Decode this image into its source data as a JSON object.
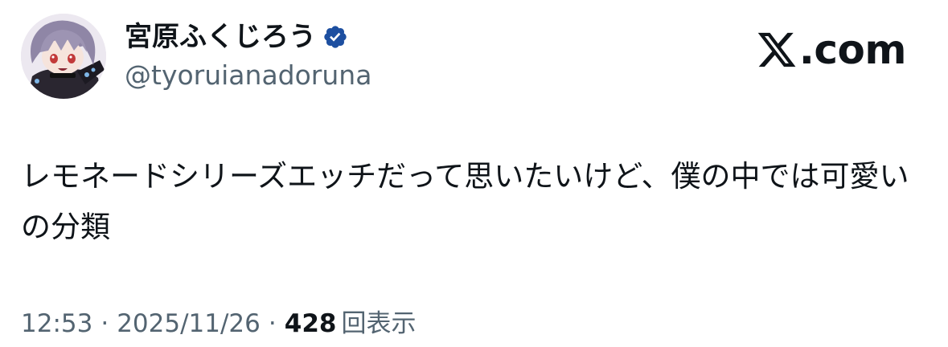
{
  "author": {
    "display_name": "宮原ふくじろう",
    "handle": "@tyoruianadoruna",
    "verified": true,
    "avatar_icon": "anime-character-avatar"
  },
  "brand": {
    "logo_icon": "x-logo-icon",
    "text": ".com"
  },
  "tweet": {
    "text": "レモネードシリーズエッチだって思いたいけど、僕の中では可愛いの分類"
  },
  "meta": {
    "time": "12:53",
    "separator": "·",
    "date": "2025/11/26",
    "views_count": "428",
    "views_label": "回表示"
  },
  "colors": {
    "text_primary": "#0f1419",
    "text_secondary": "#536471",
    "verified_blue": "#1d4fa0"
  }
}
